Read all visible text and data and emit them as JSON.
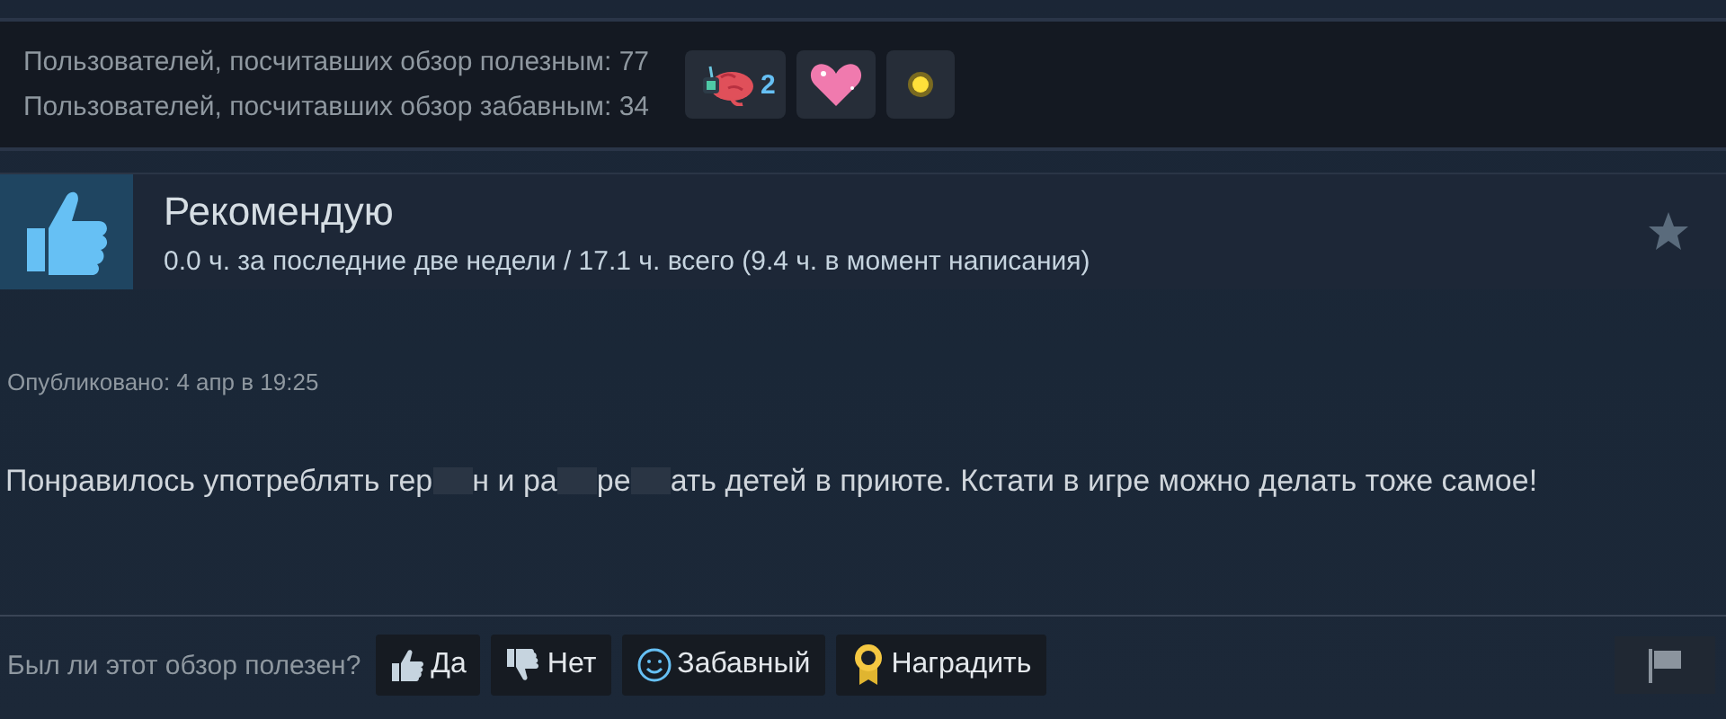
{
  "votes": [
    {
      "text": "Пользователей, посчитавших обзор полезным: 77"
    },
    {
      "text": "Пользователей, посчитавших обзор забавным: 34"
    }
  ],
  "awards": [
    {
      "kind": "brain",
      "count": "2"
    },
    {
      "kind": "heart"
    },
    {
      "kind": "sun"
    }
  ],
  "recommendation": {
    "title": "Рекомендую",
    "hours": "0.0 ч. за последние две недели / 17.1 ч. всего (9.4 ч. в момент написания)"
  },
  "published": "Опубликовано: 4 апр в 19:25",
  "body": [
    {
      "kind": "text",
      "text": "Понравилось употреблять гер"
    },
    {
      "kind": "redacted"
    },
    {
      "kind": "text",
      "text": "н и ра"
    },
    {
      "kind": "redacted"
    },
    {
      "kind": "text",
      "text": "ре"
    },
    {
      "kind": "redacted"
    },
    {
      "kind": "text",
      "text": "ать детей в приюте. Кстати в игре можно делать тоже самое!"
    }
  ],
  "footer": {
    "question": "Был ли этот обзор полезен?",
    "buttons": [
      {
        "kind": "yes",
        "label": "Да"
      },
      {
        "kind": "no",
        "label": "Нет"
      },
      {
        "kind": "funny",
        "label": "Забавный"
      },
      {
        "kind": "award",
        "label": "Наградить"
      }
    ]
  }
}
